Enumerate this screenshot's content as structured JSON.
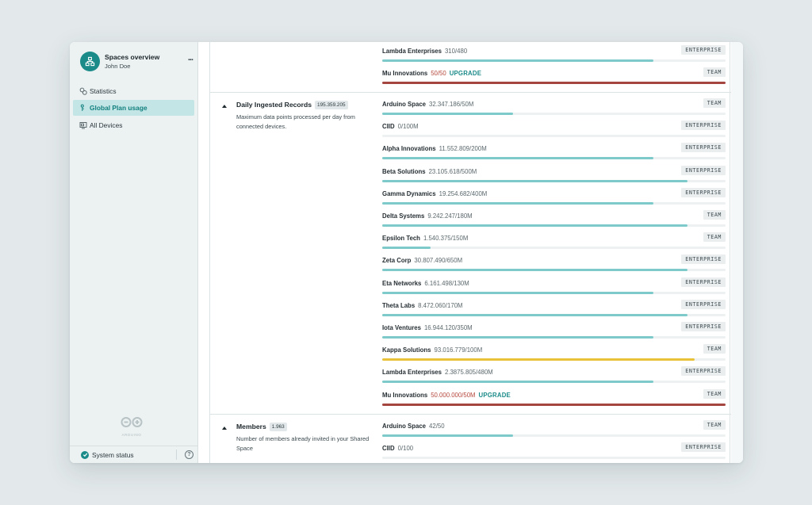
{
  "sidebar": {
    "space_title": "Spaces overview",
    "user_name": "John Doe",
    "menu": "...",
    "nav": [
      {
        "label": "Statistics",
        "icon": "statistics-icon",
        "active": false
      },
      {
        "label": "Global Plan usage",
        "icon": "plan-usage-icon",
        "active": true
      },
      {
        "label": "All Devices",
        "icon": "devices-icon",
        "active": false
      }
    ],
    "logo_text": "ARDUINO",
    "status_label": "System status",
    "help": "?"
  },
  "colors": {
    "accent": "#1b8b89",
    "bar_normal": "#7ecaca",
    "bar_warning": "#e9c23a",
    "bar_critical": "#a4463f",
    "active_nav_bg": "#c4e5e5"
  },
  "sections": [
    {
      "key": "previous",
      "title": "",
      "badge": "",
      "description": "",
      "rows": [
        {
          "name": "Lambda Enterprises",
          "usage": "310/480",
          "plan": "ENTERPRISE",
          "fill": 0.79,
          "state": "normal",
          "upgrade": ""
        },
        {
          "name": "Mu Innovations",
          "usage": "50/50",
          "plan": "TEAM",
          "fill": 1.0,
          "state": "critical",
          "upgrade": "UPGRADE"
        }
      ]
    },
    {
      "key": "daily-ingested-records",
      "title": "Daily Ingested Records",
      "badge": "195.359.205",
      "description": "Maximum data points processed per day from connected devices.",
      "rows": [
        {
          "name": "Arduino Space",
          "usage": "32.347.186/50M",
          "plan": "TEAM",
          "fill": 0.38,
          "state": "normal",
          "upgrade": ""
        },
        {
          "name": "CIID",
          "usage": "0/100M",
          "plan": "ENTERPRISE",
          "fill": 0.0,
          "state": "normal",
          "upgrade": ""
        },
        {
          "name": "Alpha Innovations",
          "usage": "11.552.809/200M",
          "plan": "ENTERPRISE",
          "fill": 0.79,
          "state": "normal",
          "upgrade": ""
        },
        {
          "name": "Beta Solutions",
          "usage": "23.105.618/500M",
          "plan": "ENTERPRISE",
          "fill": 0.89,
          "state": "normal",
          "upgrade": ""
        },
        {
          "name": "Gamma Dynamics",
          "usage": "19.254.682/400M",
          "plan": "ENTERPRISE",
          "fill": 0.79,
          "state": "normal",
          "upgrade": ""
        },
        {
          "name": "Delta Systems",
          "usage": "9.242.247/180M",
          "plan": "TEAM",
          "fill": 0.89,
          "state": "normal",
          "upgrade": ""
        },
        {
          "name": "Epsilon Tech",
          "usage": "1.540.375/150M",
          "plan": "TEAM",
          "fill": 0.14,
          "state": "normal",
          "upgrade": ""
        },
        {
          "name": "Zeta Corp",
          "usage": "30.807.490/650M",
          "plan": "ENTERPRISE",
          "fill": 0.89,
          "state": "normal",
          "upgrade": ""
        },
        {
          "name": "Eta Networks",
          "usage": "6.161.498/130M",
          "plan": "ENTERPRISE",
          "fill": 0.79,
          "state": "normal",
          "upgrade": ""
        },
        {
          "name": "Theta Labs",
          "usage": "8.472.060/170M",
          "plan": "ENTERPRISE",
          "fill": 0.89,
          "state": "normal",
          "upgrade": ""
        },
        {
          "name": "Iota Ventures",
          "usage": "16.944.120/350M",
          "plan": "ENTERPRISE",
          "fill": 0.79,
          "state": "normal",
          "upgrade": ""
        },
        {
          "name": "Kappa Solutions",
          "usage": "93.016.779/100M",
          "plan": "TEAM",
          "fill": 0.91,
          "state": "warning",
          "upgrade": ""
        },
        {
          "name": "Lambda Enterprises",
          "usage": "2.3875.805/480M",
          "plan": "ENTERPRISE",
          "fill": 0.79,
          "state": "normal",
          "upgrade": ""
        },
        {
          "name": "Mu Innovations",
          "usage": "50.000.000/50M",
          "plan": "TEAM",
          "fill": 1.0,
          "state": "critical",
          "upgrade": "UPGRADE"
        }
      ]
    },
    {
      "key": "members",
      "title": "Members",
      "badge": "1.963",
      "description": "Number of members already invited in your Shared Space",
      "rows": [
        {
          "name": "Arduino Space",
          "usage": "42/50",
          "plan": "TEAM",
          "fill": 0.38,
          "state": "normal",
          "upgrade": ""
        },
        {
          "name": "CIID",
          "usage": "0/100",
          "plan": "ENTERPRISE",
          "fill": 0.0,
          "state": "normal",
          "upgrade": ""
        }
      ]
    }
  ]
}
